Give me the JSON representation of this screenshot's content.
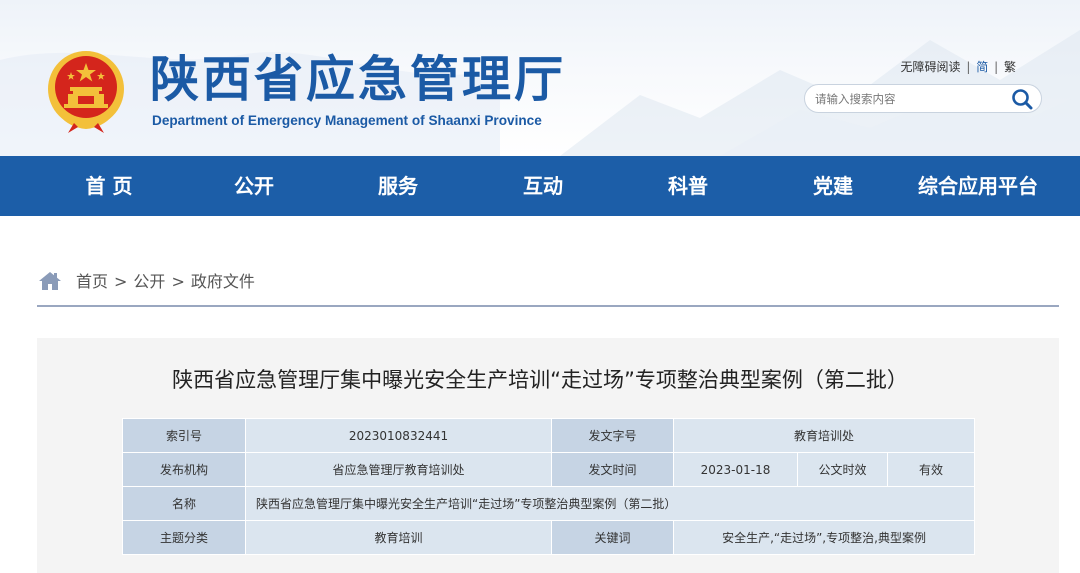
{
  "header": {
    "site_title": "陕西省应急管理厅",
    "site_subtitle": "Department of Emergency Management of Shaanxi Province",
    "top_links": {
      "accessibility": "无障碍阅读",
      "simplified": "简",
      "traditional": "繁",
      "separator": "|"
    },
    "search": {
      "placeholder": "请输入搜索内容"
    }
  },
  "nav": {
    "items": [
      {
        "label": "首 页"
      },
      {
        "label": "公开"
      },
      {
        "label": "服务"
      },
      {
        "label": "互动"
      },
      {
        "label": "科普"
      },
      {
        "label": "党建"
      },
      {
        "label": "综合应用平台"
      }
    ]
  },
  "breadcrumb": {
    "items": [
      "首页",
      "公开",
      "政府文件"
    ],
    "separator": ">"
  },
  "article": {
    "title": "陕西省应急管理厅集中曝光安全生产培训“走过场”专项整治典型案例（第二批）",
    "meta": {
      "index_label": "索引号",
      "index_value": "2023010832441",
      "doc_no_label": "发文字号",
      "doc_no_value": "教育培训处",
      "publisher_label": "发布机构",
      "publisher_value": "省应急管理厅教育培训处",
      "date_label": "发文时间",
      "date_value": "2023-01-18",
      "validity_label": "公文时效",
      "validity_value": "有效",
      "name_label": "名称",
      "name_value": "陕西省应急管理厅集中曝光安全生产培训“走过场”专项整治典型案例（第二批）",
      "topic_label": "主题分类",
      "topic_value": "教育培训",
      "keywords_label": "关键词",
      "keywords_value": "安全生产,“走过场”,专项整治,典型案例"
    }
  },
  "colors": {
    "brand_blue": "#1b5aa5",
    "nav_blue": "#1c5ea8",
    "table_label_bg": "#c6d4e4",
    "table_value_bg": "#dbe5ef",
    "panel_bg": "#f4f4f4",
    "emblem_red": "#d4251c",
    "emblem_gold": "#f3c03a"
  }
}
